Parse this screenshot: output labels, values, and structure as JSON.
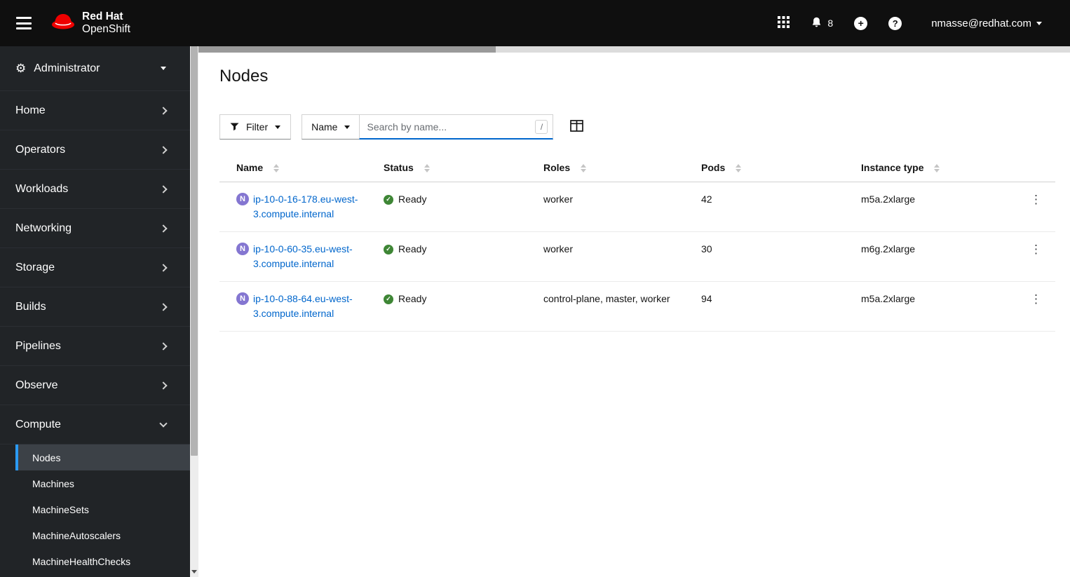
{
  "masthead": {
    "brand_line1": "Red Hat",
    "brand_line2": "OpenShift",
    "notification_count": "8",
    "username": "nmasse@redhat.com"
  },
  "sidebar": {
    "perspective": "Administrator",
    "items": [
      "Home",
      "Operators",
      "Workloads",
      "Networking",
      "Storage",
      "Builds",
      "Pipelines",
      "Observe",
      "Compute"
    ],
    "compute_items": [
      "Nodes",
      "Machines",
      "MachineSets",
      "MachineAutoscalers",
      "MachineHealthChecks"
    ],
    "current_item": "Nodes"
  },
  "page": {
    "title": "Nodes",
    "toolbar": {
      "filter_label": "Filter",
      "search_attribute": "Name",
      "search_placeholder": "Search by name...",
      "search_shortcut_key": "/"
    },
    "table": {
      "columns": [
        "Name",
        "Status",
        "Roles",
        "Pods",
        "Instance type"
      ],
      "node_badge_letter": "N",
      "rows": [
        {
          "name": "ip-10-0-16-178.eu-west-3.compute.internal",
          "status": "Ready",
          "roles": "worker",
          "pods": "42",
          "instance_type": "m5a.2xlarge"
        },
        {
          "name": "ip-10-0-60-35.eu-west-3.compute.internal",
          "status": "Ready",
          "roles": "worker",
          "pods": "30",
          "instance_type": "m6g.2xlarge"
        },
        {
          "name": "ip-10-0-88-64.eu-west-3.compute.internal",
          "status": "Ready",
          "roles": "control-plane, master, worker",
          "pods": "94",
          "instance_type": "m5a.2xlarge"
        }
      ]
    }
  },
  "colors": {
    "masthead_bg": "#0f0f0f",
    "sidebar_bg": "#212427",
    "nav_current_bg": "#3c4147",
    "nav_current_indicator": "#2b9af3",
    "link_blue": "#0066cc",
    "status_ready_green": "#3e8635",
    "node_badge_purple": "#8476d1",
    "brand_red": "#ee0000"
  }
}
